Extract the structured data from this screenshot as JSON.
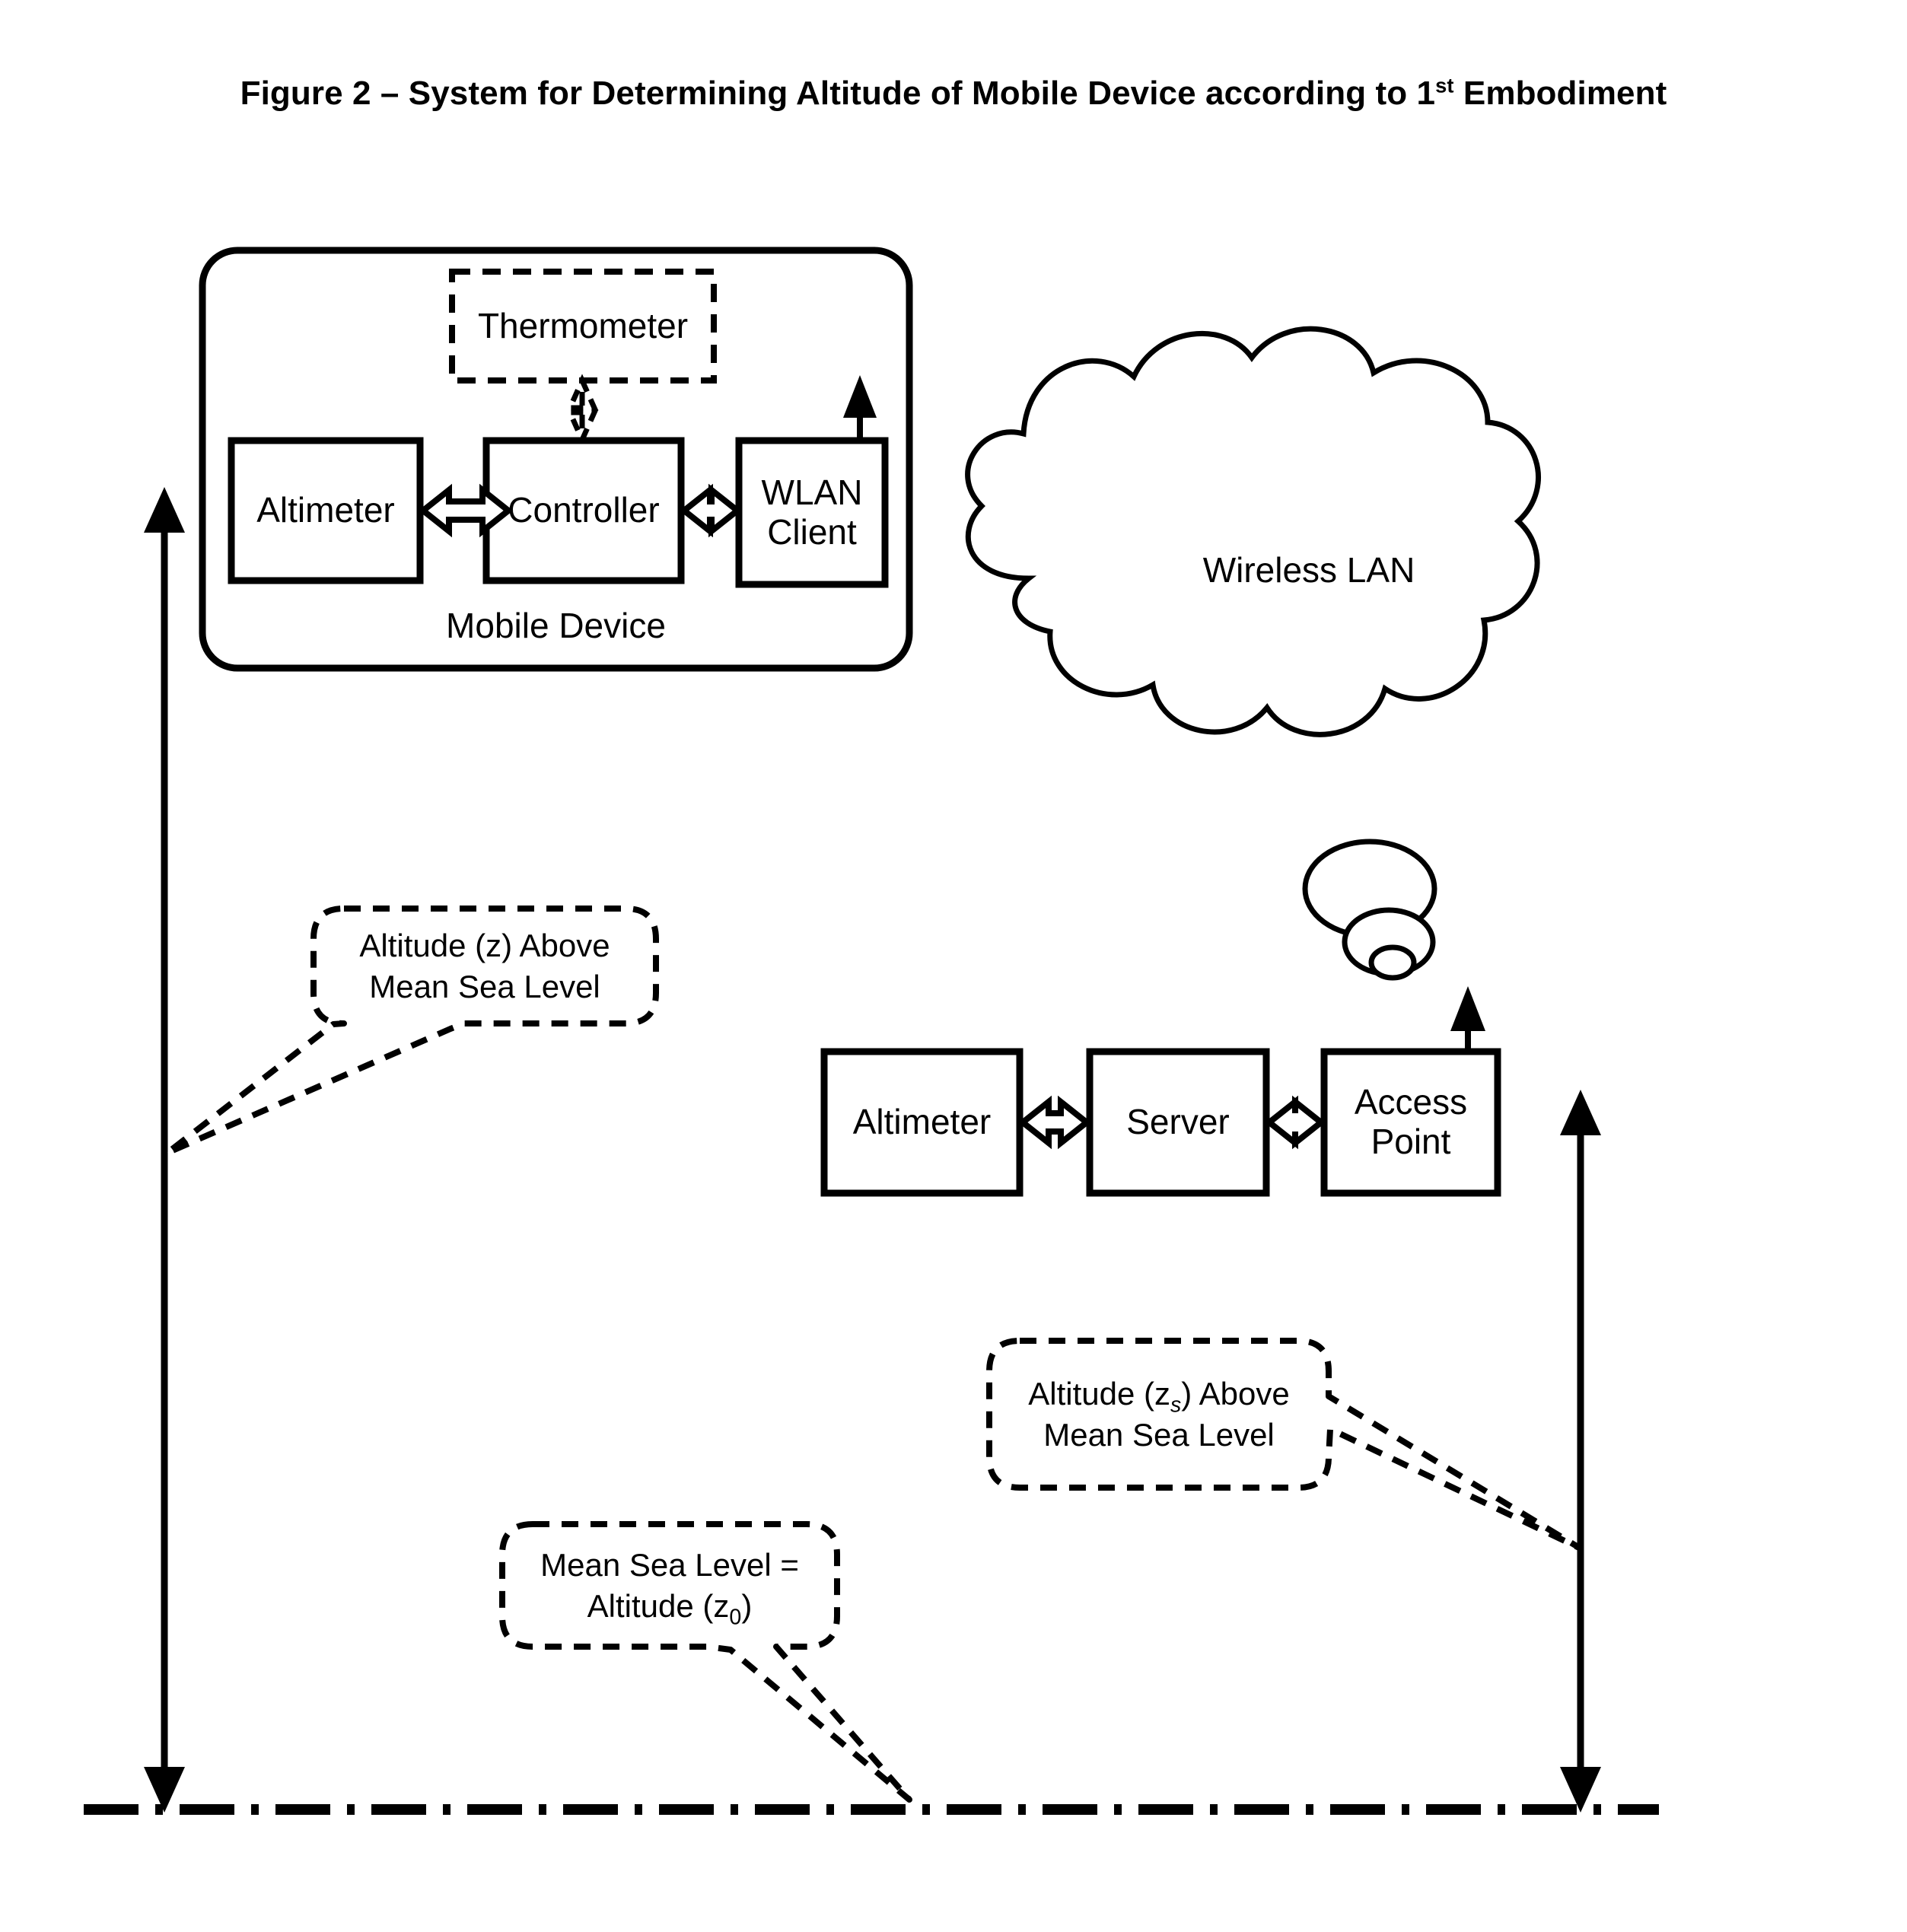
{
  "figure": {
    "title_prefix": "Figure 2 – System for Determining Altitude of Mobile Device according to 1",
    "title_superscript": "st",
    "title_suffix": " Embodiment",
    "title_full": "Figure 2 – System for Determining Altitude of Mobile Device according to 1st Embodiment"
  },
  "colors": {
    "stroke": "#000000",
    "background": "#ffffff"
  },
  "mobile_device": {
    "group_label": "Mobile Device",
    "blocks": {
      "thermometer": "Thermometer",
      "altimeter": "Altimeter",
      "controller": "Controller",
      "wlan_client_line1": "WLAN",
      "wlan_client_line2": "Client"
    }
  },
  "network": {
    "cloud_label": "Wireless LAN"
  },
  "server_side": {
    "blocks": {
      "altimeter": "Altimeter",
      "server": "Server",
      "access_point_line1": "Access",
      "access_point_line2": "Point"
    }
  },
  "callouts": {
    "altitude_z": {
      "line1": "Altitude (z) Above",
      "line2": "Mean Sea Level"
    },
    "altitude_zs": {
      "line1_pre": "Altitude (z",
      "line1_sub": "s",
      "line1_post": ") Above",
      "line2": "Mean Sea Level"
    },
    "mean_sea_level": {
      "line1": "Mean Sea Level =",
      "line2_pre": "Altitude (z",
      "line2_sub": "0",
      "line2_post": ")"
    }
  }
}
